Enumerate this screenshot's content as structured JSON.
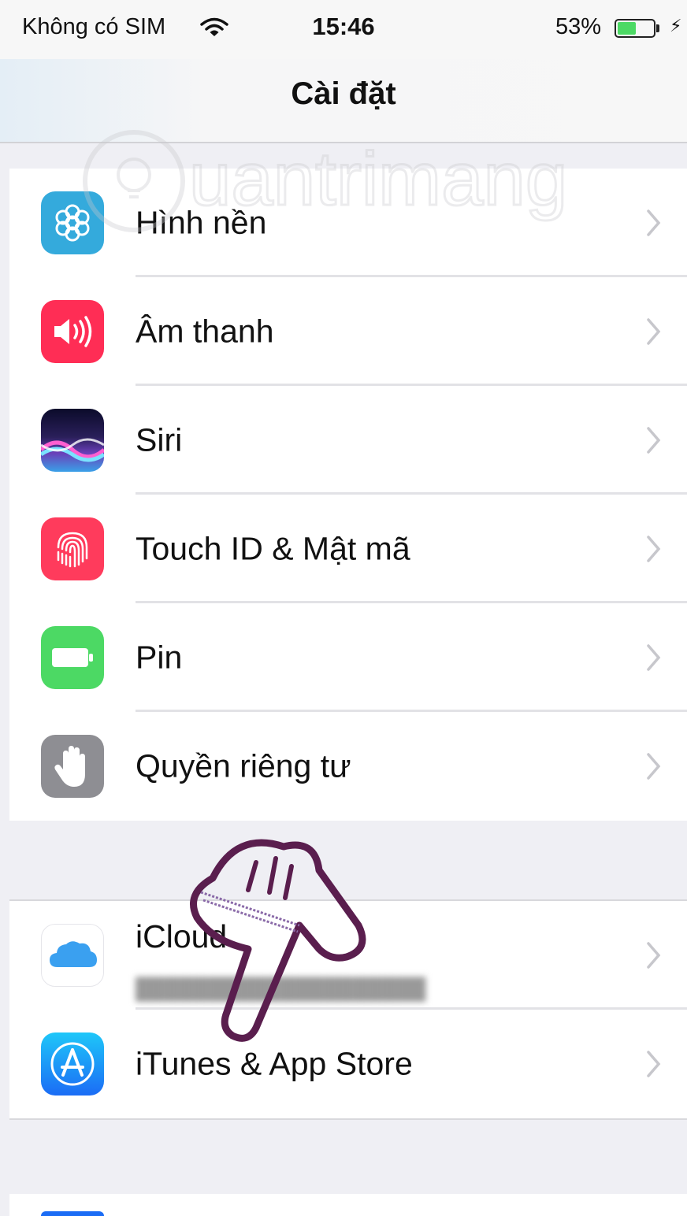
{
  "status_bar": {
    "carrier": "Không có SIM",
    "time": "15:46",
    "battery_percent": "53%",
    "battery_level": 0.53
  },
  "nav": {
    "title": "Cài đặt"
  },
  "group1": [
    {
      "label": "Hình nền",
      "icon": "wallpaper-icon",
      "color": "#34aadc"
    },
    {
      "label": "Âm thanh",
      "icon": "speaker-icon",
      "color": "#ff2d55"
    },
    {
      "label": "Siri",
      "icon": "siri-icon",
      "color": "#1a1a3a"
    },
    {
      "label": "Touch ID & Mật mã",
      "icon": "fingerprint-icon",
      "color": "#ff3b5c"
    },
    {
      "label": "Pin",
      "icon": "battery-icon",
      "color": "#4cd964"
    },
    {
      "label": "Quyền riêng tư",
      "icon": "hand-icon",
      "color": "#8e8e93"
    }
  ],
  "group2": [
    {
      "label": "iCloud",
      "icon": "icloud-icon",
      "color": "#ffffff"
    },
    {
      "label": "iTunes & App Store",
      "icon": "appstore-icon",
      "color": "#1b8cf5"
    }
  ],
  "watermark": "Quantrimang"
}
